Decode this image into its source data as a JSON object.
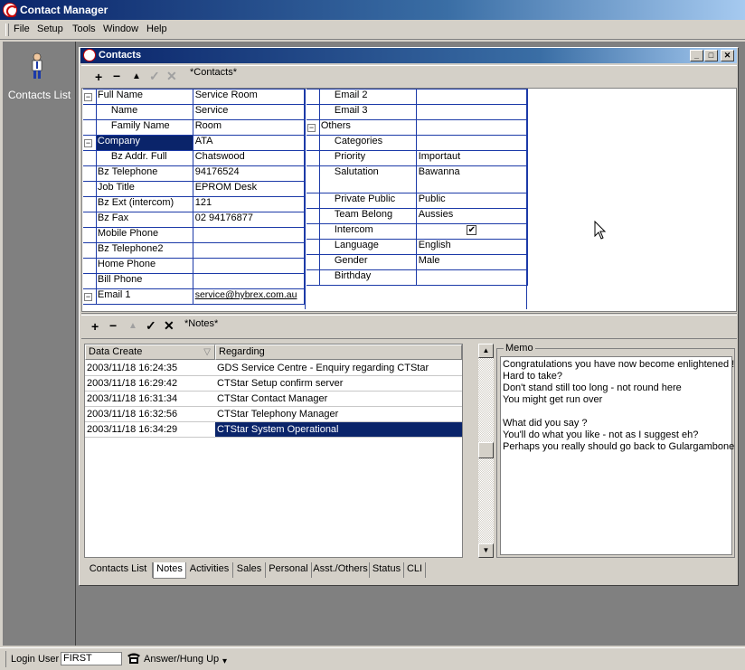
{
  "app": {
    "title": "Contact Manager"
  },
  "menu": [
    "File",
    "Setup",
    "Tools",
    "Window",
    "Help"
  ],
  "left_panel": {
    "label": "Contacts List"
  },
  "window": {
    "title": "Contacts",
    "min": "_",
    "max": "□",
    "close": "✕"
  },
  "top_toolbar": {
    "add": "+",
    "remove": "−",
    "up": "▲",
    "ok": "✓",
    "cancel": "✕",
    "label": "*Contacts*"
  },
  "left_fields": [
    {
      "label": "Full Name",
      "value": "Service Room",
      "expander": "−",
      "indent": 0
    },
    {
      "label": "Name",
      "value": "Service",
      "indent": 1
    },
    {
      "label": "Family Name",
      "value": "Room",
      "indent": 1
    },
    {
      "label": "Company",
      "value": "ATA",
      "expander": "−",
      "indent": 0,
      "selected": true
    },
    {
      "label": "Bz Addr. Full",
      "value": "Chatswood",
      "indent": 1
    },
    {
      "label": "Bz Telephone",
      "value": "94176524",
      "indent": 0
    },
    {
      "label": "Job Title",
      "value": "EPROM Desk",
      "indent": 0
    },
    {
      "label": "Bz Ext (intercom)",
      "value": "121",
      "indent": 0
    },
    {
      "label": "Bz Fax",
      "value": "02 94176877",
      "indent": 0
    },
    {
      "label": "Mobile Phone",
      "value": "",
      "indent": 0
    },
    {
      "label": "Bz Telephone2",
      "value": "",
      "indent": 0
    },
    {
      "label": "Home Phone",
      "value": "",
      "indent": 0
    },
    {
      "label": "Bill Phone",
      "value": "",
      "indent": 0
    },
    {
      "label": "Email 1",
      "value": "service@hybrex.com.au",
      "expander": "−",
      "indent": 0
    }
  ],
  "right_fields": [
    {
      "label": "Email 2",
      "value": "",
      "indent": 1
    },
    {
      "label": "Email 3",
      "value": "",
      "indent": 1
    },
    {
      "label": "Others",
      "value": "",
      "expander": "−",
      "indent": 0
    },
    {
      "label": "Categories",
      "value": "",
      "indent": 1
    },
    {
      "label": "Priority",
      "value": "Importaut",
      "indent": 1
    },
    {
      "label": "Salutation",
      "value": "Bawanna",
      "indent": 1,
      "tall": true
    },
    {
      "label": "Private Public",
      "value": "Public",
      "indent": 1
    },
    {
      "label": "Team Belong",
      "value": "Aussies",
      "indent": 1
    },
    {
      "label": "Intercom",
      "value": "",
      "indent": 1,
      "checkbox": "✔"
    },
    {
      "label": "Language",
      "value": "English",
      "indent": 1
    },
    {
      "label": "Gender",
      "value": "Male",
      "indent": 1
    },
    {
      "label": "Birthday",
      "value": "",
      "indent": 1
    }
  ],
  "notes_toolbar": {
    "add": "+",
    "remove": "−",
    "up": "▲",
    "ok": "✓",
    "cancel": "✕",
    "label": "*Notes*"
  },
  "notes": {
    "columns": [
      "Data Create",
      "Regarding"
    ],
    "sort_glyph": "▽",
    "rows": [
      {
        "date": "2003/11/18 16:24:35",
        "regarding": "GDS Service Centre - Enquiry regarding CTStar"
      },
      {
        "date": "2003/11/18 16:29:42",
        "regarding": "CTStar Setup confirm server"
      },
      {
        "date": "2003/11/18 16:31:34",
        "regarding": "CTStar Contact Manager"
      },
      {
        "date": "2003/11/18 16:32:56",
        "regarding": "CTStar Telephony Manager"
      },
      {
        "date": "2003/11/18 16:34:29",
        "regarding": "CTStar System Operational",
        "selected": true
      }
    ]
  },
  "scroll": {
    "up": "▲",
    "down": "▼"
  },
  "memo": {
    "label": "Memo",
    "lines": [
      "Congratulations you have now become enlightened !",
      "Hard to take?",
      "Don't stand still too long - not round here",
      "You might get run over",
      "",
      "What did you say ?",
      "You'll do what you like - not as I suggest eh?",
      "Perhaps you really should go back to Gulargambone"
    ]
  },
  "tabs": [
    {
      "label": "Contacts List",
      "w": 76
    },
    {
      "label": "Notes",
      "w": 37,
      "active": true
    },
    {
      "label": "Activities",
      "w": 52
    },
    {
      "label": "Sales",
      "w": 36
    },
    {
      "label": "Personal",
      "w": 51
    },
    {
      "label": "Asst./Others",
      "w": 64
    },
    {
      "label": "Status",
      "w": 38
    },
    {
      "label": "CLI",
      "w": 24
    }
  ],
  "status": {
    "login_label": "Login User",
    "login_value": "FIRST",
    "phone_label": "Answer/Hung Up",
    "dropdown": "▾"
  }
}
